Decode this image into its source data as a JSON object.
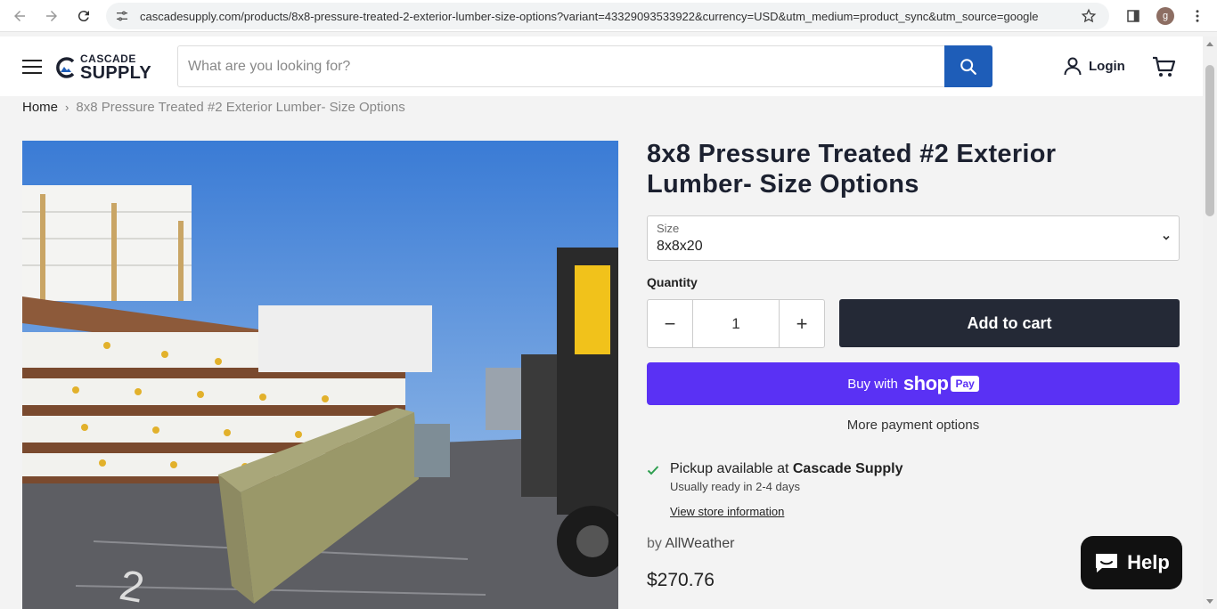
{
  "browser": {
    "url": "cascadesupply.com/products/8x8-pressure-treated-2-exterior-lumber-size-options?variant=43329093533922&currency=USD&utm_medium=product_sync&utm_source=google",
    "profile_initial": "g"
  },
  "header": {
    "logo_line1": "CASCADE",
    "logo_line2": "SUPPLY",
    "search_placeholder": "What are you looking for?",
    "login_label": "Login"
  },
  "breadcrumb": {
    "home": "Home",
    "separator": "›",
    "current": "8x8 Pressure Treated #2 Exterior Lumber- Size Options"
  },
  "product": {
    "title": "8x8 Pressure Treated #2 Exterior Lumber- Size Options",
    "size_label": "Size",
    "size_value": "8x8x20",
    "quantity_label": "Quantity",
    "quantity_value": "1",
    "minus_label": "−",
    "plus_label": "+",
    "add_to_cart": "Add to cart",
    "shop_pay_prefix": "Buy with",
    "shop_pay_brand": "shop",
    "shop_pay_badge": "Pay",
    "more_payment": "More payment options",
    "pickup_prefix": "Pickup available at",
    "pickup_location": "Cascade Supply",
    "pickup_ready": "Usually ready in 2-4 days",
    "store_info_link": "View store information",
    "vendor_prefix": "by",
    "vendor_name": "AllWeather",
    "price": "$270.76"
  },
  "chat": {
    "help_label": "Help"
  },
  "colors": {
    "search_button": "#1e5db8",
    "add_to_cart": "#242936",
    "shop_pay": "#5a31f4",
    "check": "#2e9e4f"
  }
}
